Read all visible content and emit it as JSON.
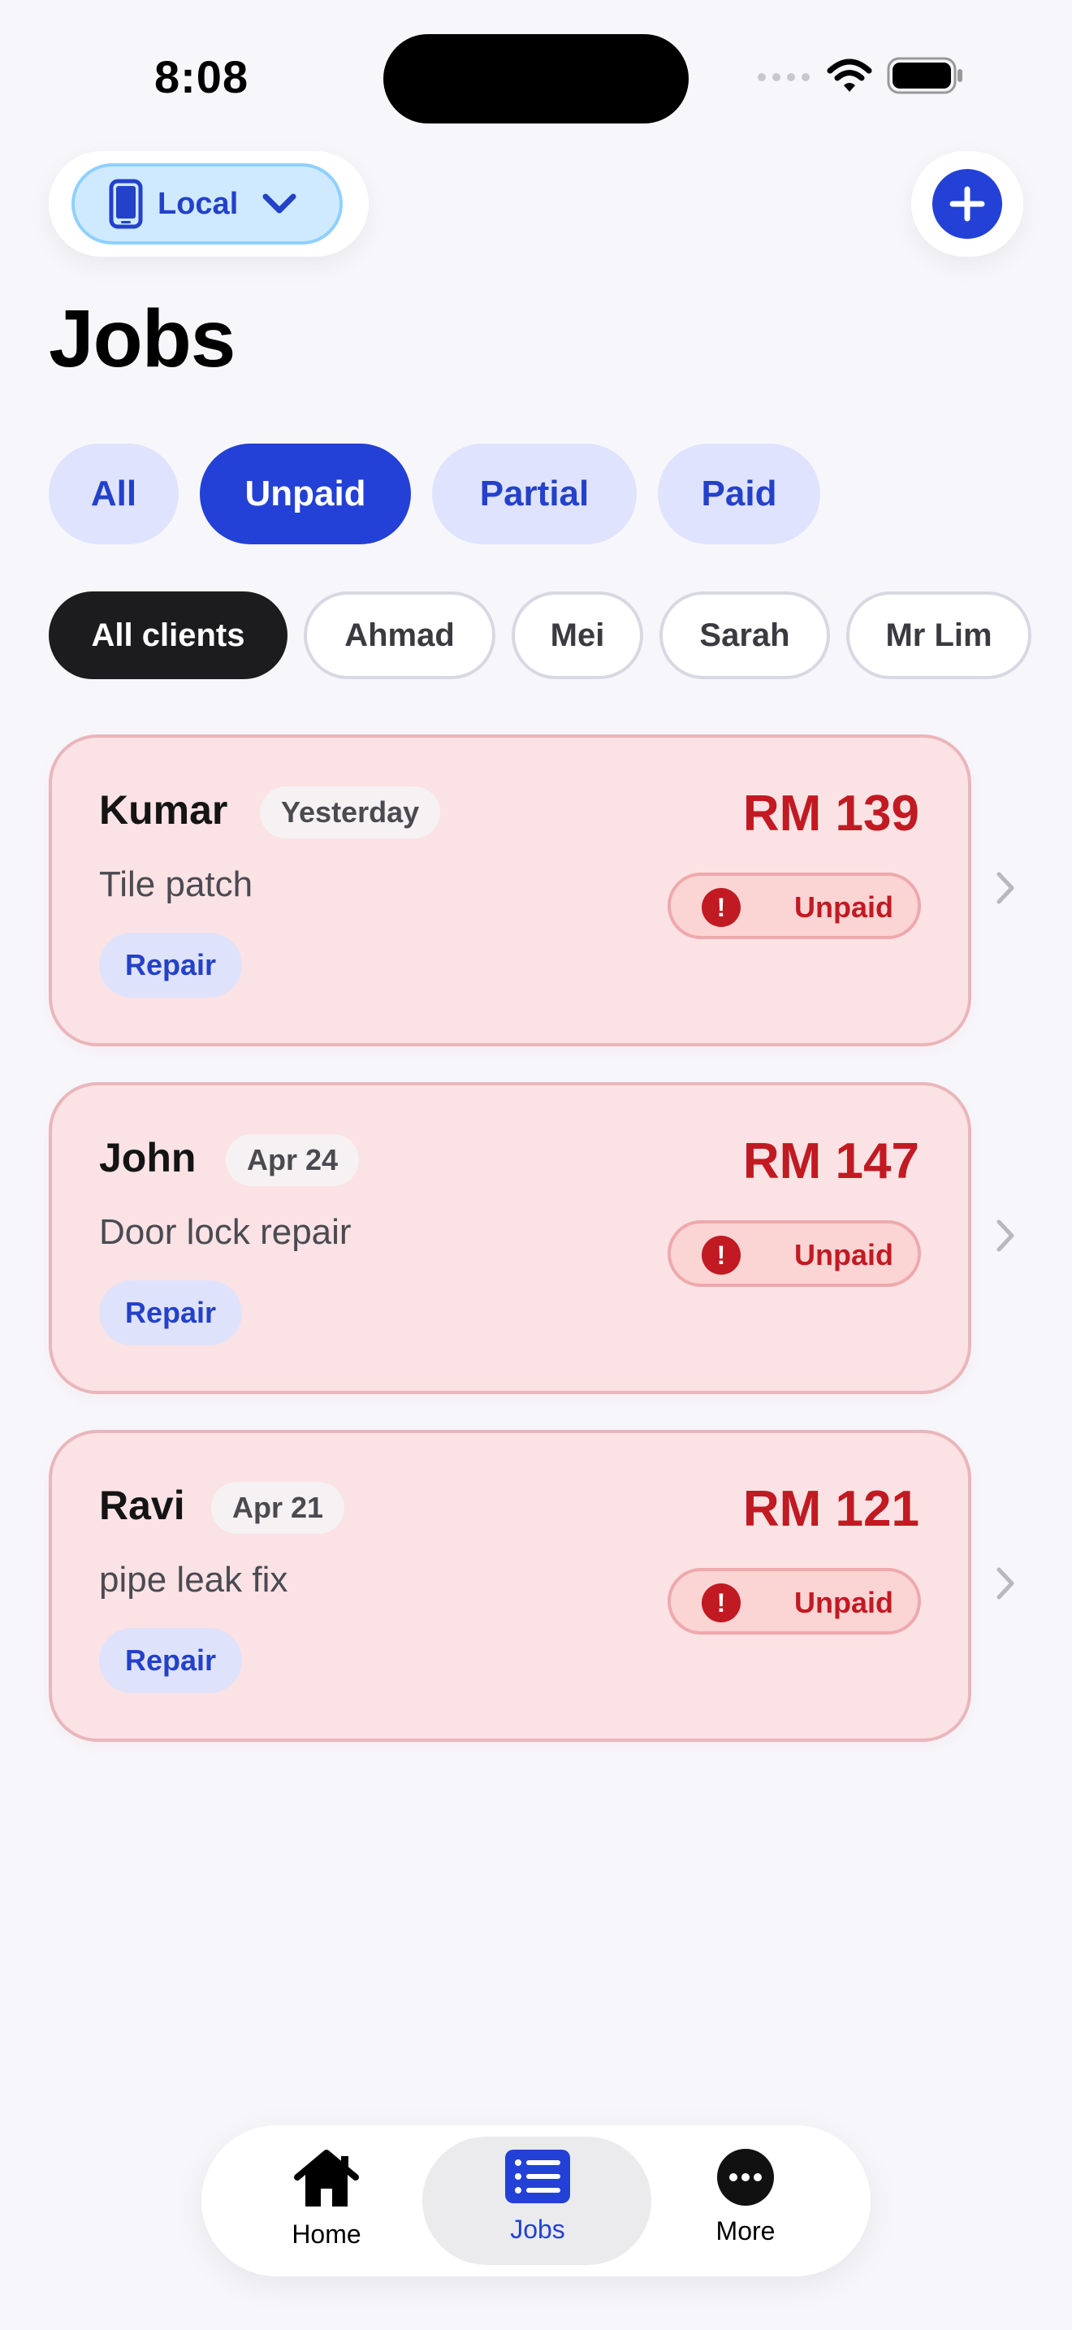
{
  "status_bar": {
    "time": "8:08"
  },
  "header": {
    "source_label": "Local",
    "source_icon": "phone-icon",
    "add_icon": "plus-icon",
    "title": "Jobs"
  },
  "status_filter": [
    {
      "label": "All",
      "active": false
    },
    {
      "label": "Unpaid",
      "active": true
    },
    {
      "label": "Partial",
      "active": false
    },
    {
      "label": "Paid",
      "active": false
    }
  ],
  "client_filter": [
    {
      "label": "All clients",
      "active": true
    },
    {
      "label": "Ahmad",
      "active": false
    },
    {
      "label": "Mei",
      "active": false
    },
    {
      "label": "Sarah",
      "active": false
    },
    {
      "label": "Mr Lim",
      "active": false
    }
  ],
  "jobs": [
    {
      "client": "Kumar",
      "date": "Yesterday",
      "description": "Tile patch",
      "tag": "Repair",
      "amount": "RM 139",
      "status": "Unpaid"
    },
    {
      "client": "John",
      "date": "Apr 24",
      "description": "Door lock repair",
      "tag": "Repair",
      "amount": "RM 147",
      "status": "Unpaid"
    },
    {
      "client": "Ravi",
      "date": "Apr 21",
      "description": "pipe leak fix",
      "tag": "Repair",
      "amount": "RM 121",
      "status": "Unpaid"
    }
  ],
  "tab_bar": [
    {
      "label": "Home",
      "icon": "house-icon",
      "active": false
    },
    {
      "label": "Jobs",
      "icon": "list-icon",
      "active": true
    },
    {
      "label": "More",
      "icon": "ellipsis-icon",
      "active": false
    }
  ],
  "colors": {
    "accent": "#2341d6",
    "unpaid_red": "#c11a22",
    "card_bg": "#fbe2e4",
    "background": "#f7f7fb"
  }
}
